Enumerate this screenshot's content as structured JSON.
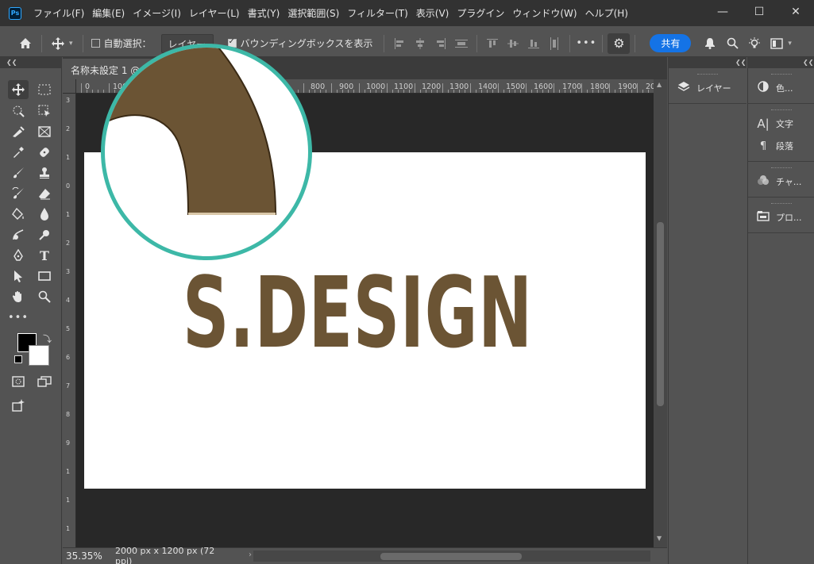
{
  "app": {
    "logo": "Ps"
  },
  "menu": [
    "ファイル(F)",
    "編集(E)",
    "イメージ(I)",
    "レイヤー(L)",
    "書式(Y)",
    "選択範囲(S)",
    "フィルター(T)",
    "表示(V)",
    "プラグイン",
    "ウィンドウ(W)",
    "ヘルプ(H)"
  ],
  "window_controls": {
    "minimize": "—",
    "maximize": "☐",
    "close": "✕"
  },
  "options": {
    "auto_select_label": "自動選択：",
    "layer_select_value": "レイヤー",
    "bounding_box_label": "バウンディングボックスを表示",
    "more": "•••",
    "share_label": "共有"
  },
  "document": {
    "tab_title": "名称未設定 1 @",
    "zoom": "35.35%",
    "info": "2000 px x 1200 px (72 ppi)",
    "canvas_text": "S.DESIGN",
    "text_color": "#6b5434",
    "magnifier_border_color": "#3db8a7"
  },
  "ruler": {
    "h_labels": [
      "0",
      "100",
      "800",
      "900",
      "1000",
      "1100",
      "1200",
      "1300",
      "1400",
      "1500",
      "1600",
      "1700",
      "1800",
      "1900",
      "20"
    ],
    "v_labels": [
      "3",
      "2",
      "1",
      "0",
      "1",
      "2",
      "3",
      "4",
      "5",
      "6",
      "7",
      "8",
      "9",
      "1",
      "1",
      "1"
    ]
  },
  "panels": {
    "col1": [
      {
        "icon": "layers-icon",
        "label": "レイヤー"
      }
    ],
    "col2": [
      {
        "icon": "color-icon",
        "label": "色..."
      },
      {
        "icon": "character-icon",
        "label": "文字"
      },
      {
        "icon": "paragraph-icon",
        "label": "段落"
      },
      {
        "icon": "channels-icon",
        "label": "チャ..."
      },
      {
        "icon": "properties-icon",
        "label": "プロ..."
      }
    ]
  }
}
